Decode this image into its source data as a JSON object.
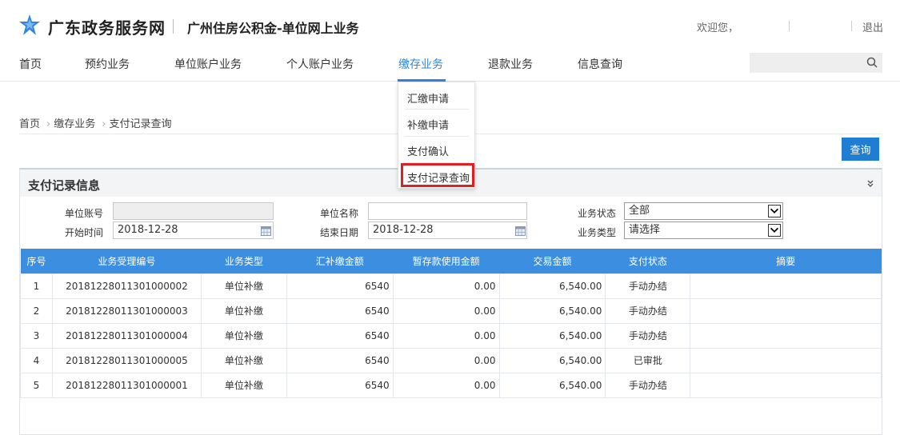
{
  "header": {
    "site_title": "广东政务服务网",
    "sub_title": "广州住房公积金-单位网上业务",
    "welcome": "欢迎您，",
    "logout": "退出",
    "logo_color": "#2e86de"
  },
  "nav": {
    "items": [
      "首页",
      "预约业务",
      "单位账户业务",
      "个人账户业务",
      "缴存业务",
      "退款业务",
      "信息查询"
    ],
    "active_index": 4,
    "active_color": "#2e86de",
    "search_icon": "search-icon"
  },
  "dropdown": {
    "items": [
      "汇缴申请",
      "补缴申请",
      "支付确认",
      "支付记录查询"
    ],
    "highlighted_index": 3
  },
  "breadcrumb": [
    "首页",
    "缴存业务",
    "支付记录查询"
  ],
  "query_button": "查询",
  "panel": {
    "title": "支付记录信息",
    "collapse_icon": "double-chevron-down-icon"
  },
  "form": {
    "unit_account_label": "单位账号",
    "unit_account_value": "",
    "unit_name_label": "单位名称",
    "unit_name_value": "",
    "status_label": "业务状态",
    "status_value": "全部",
    "start_label": "开始时间",
    "start_value": "2018-12-28",
    "end_label": "结束日期",
    "end_value": "2018-12-28",
    "type_label": "业务类型",
    "type_value": "请选择"
  },
  "table": {
    "columns": [
      "序号",
      "业务受理编号",
      "业务类型",
      "汇补缴金额",
      "暂存款使用金额",
      "交易金额",
      "支付状态",
      "摘要"
    ],
    "rows": [
      [
        "1",
        "20181228011301000002",
        "单位补缴",
        "6540",
        "0.00",
        "6,540.00",
        "手动办结",
        ""
      ],
      [
        "2",
        "20181228011301000003",
        "单位补缴",
        "6540",
        "0.00",
        "6,540.00",
        "手动办结",
        ""
      ],
      [
        "3",
        "20181228011301000004",
        "单位补缴",
        "6540",
        "0.00",
        "6,540.00",
        "手动办结",
        ""
      ],
      [
        "4",
        "20181228011301000005",
        "单位补缴",
        "6540",
        "0.00",
        "6,540.00",
        "已审批",
        ""
      ],
      [
        "5",
        "20181228011301000001",
        "单位补缴",
        "6540",
        "0.00",
        "6,540.00",
        "手动办结",
        ""
      ]
    ]
  }
}
